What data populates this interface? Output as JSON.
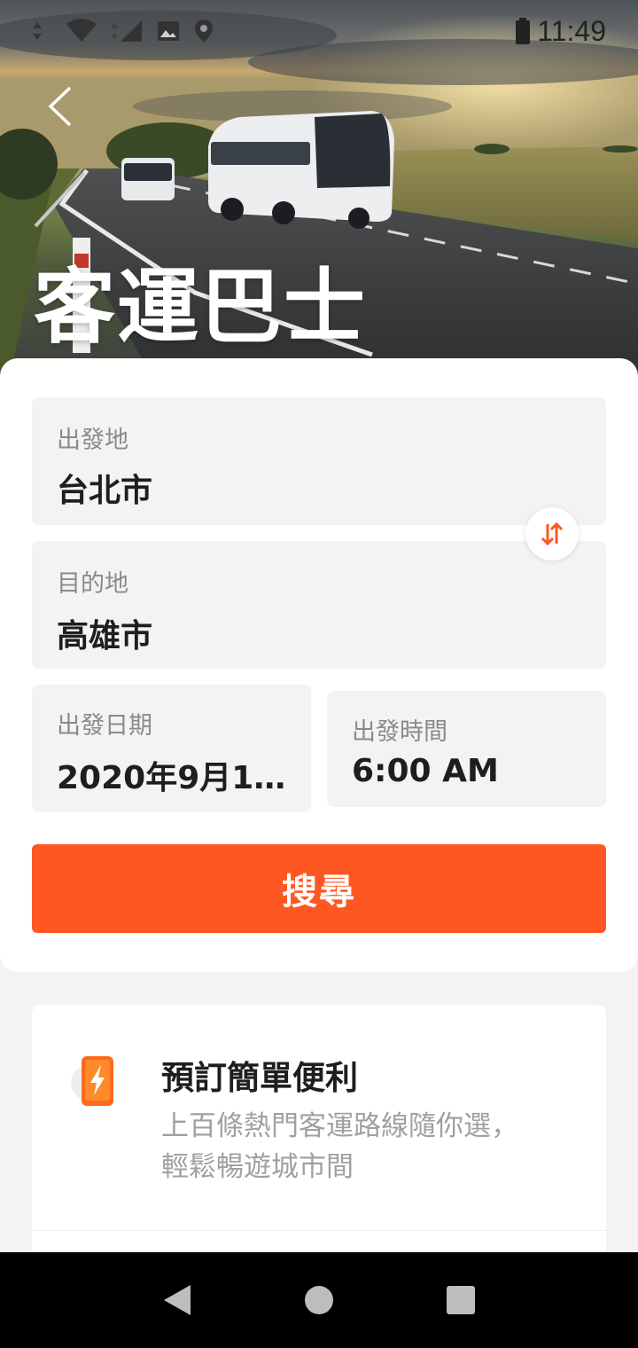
{
  "status_bar": {
    "time": "11:49"
  },
  "hero": {
    "title": "客運巴士"
  },
  "form": {
    "origin": {
      "label": "出發地",
      "value": "台北市"
    },
    "destination": {
      "label": "目的地",
      "value": "高雄市"
    },
    "date": {
      "label": "出發日期",
      "value": "2020年9月1…"
    },
    "time": {
      "label": "出發時間",
      "value": "6:00 AM"
    },
    "search_label": "搜尋"
  },
  "feature": {
    "title": "預訂簡單便利",
    "description_line1": "上百條熱門客運路線隨你選，",
    "description_line2": "輕鬆暢遊城市間",
    "icon": "phone-lightning-icon"
  },
  "colors": {
    "accent": "#ff5722",
    "field_bg": "#f3f3f3",
    "nav_bg": "#000000"
  }
}
